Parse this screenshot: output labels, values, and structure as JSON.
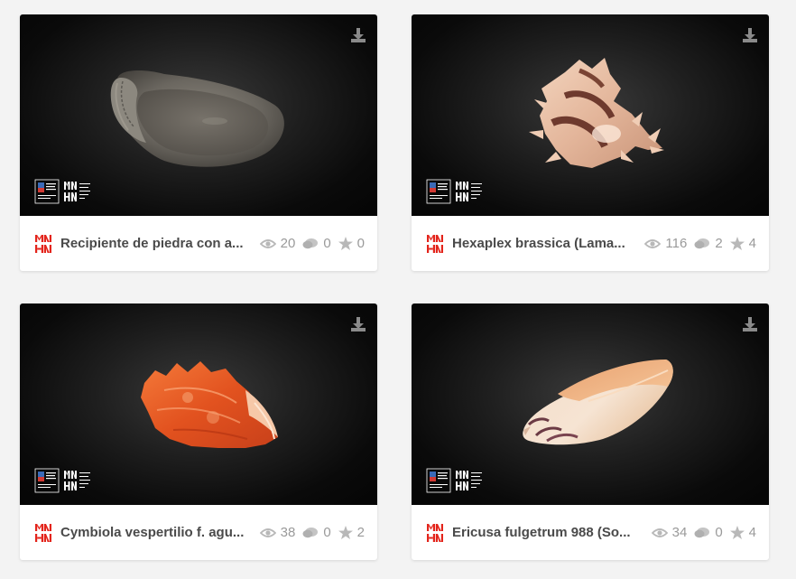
{
  "colors": {
    "brand_red": "#e3241b",
    "title_text": "#4a4a4a",
    "stat_text": "#9a9a9a",
    "page_bg": "#f3f3f3"
  },
  "icons": {
    "download": "download-icon",
    "views": "eye-icon",
    "comments": "comment-icon",
    "likes": "star-icon",
    "publisher": "mnhn-logo"
  },
  "cards": [
    {
      "title": "Recipiente de piedra con a...",
      "views": "20",
      "comments": "0",
      "likes": "0"
    },
    {
      "title": "Hexaplex brassica (Lama...",
      "views": "116",
      "comments": "2",
      "likes": "4"
    },
    {
      "title": "Cymbiola vespertilio f. agu...",
      "views": "38",
      "comments": "0",
      "likes": "2"
    },
    {
      "title": "Ericusa fulgetrum 988 (So...",
      "views": "34",
      "comments": "0",
      "likes": "4"
    }
  ]
}
